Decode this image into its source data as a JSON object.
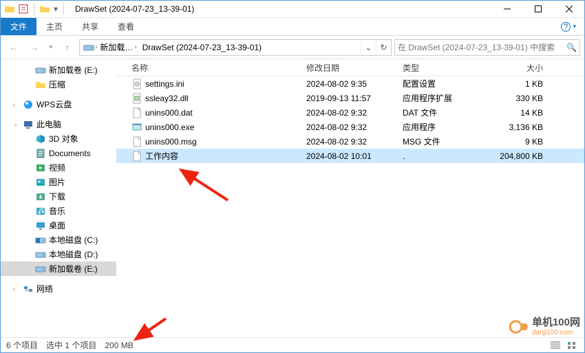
{
  "window": {
    "title": "DrawSet (2024-07-23_13-39-01)"
  },
  "ribbon": {
    "file": "文件",
    "tabs": [
      "主页",
      "共享",
      "查看"
    ]
  },
  "nav": {
    "breadcrumbs": [
      "新加载…",
      "DrawSet (2024-07-23_13-39-01)"
    ],
    "search_placeholder": "在 DrawSet (2024-07-23_13-39-01) 中搜索"
  },
  "tree": {
    "items": [
      {
        "label": "新加载卷 (E:)",
        "icon": "drive",
        "level": 1
      },
      {
        "label": "压缩",
        "icon": "folder",
        "level": 1
      },
      {
        "spacer": true
      },
      {
        "label": "WPS云盘",
        "icon": "wps",
        "level": 0
      },
      {
        "spacer": true
      },
      {
        "label": "此电脑",
        "icon": "pc",
        "level": 0,
        "expand": true
      },
      {
        "label": "3D 对象",
        "icon": "3d",
        "level": 1
      },
      {
        "label": "Documents",
        "icon": "docs",
        "level": 1
      },
      {
        "label": "视频",
        "icon": "video",
        "level": 1
      },
      {
        "label": "图片",
        "icon": "pics",
        "level": 1
      },
      {
        "label": "下载",
        "icon": "dl",
        "level": 1
      },
      {
        "label": "音乐",
        "icon": "music",
        "level": 1
      },
      {
        "label": "桌面",
        "icon": "desktop",
        "level": 1
      },
      {
        "label": "本地磁盘 (C:)",
        "icon": "drivec",
        "level": 1
      },
      {
        "label": "本地磁盘 (D:)",
        "icon": "drive",
        "level": 1
      },
      {
        "label": "新加载卷 (E:)",
        "icon": "drive",
        "level": 1,
        "selected": true
      },
      {
        "spacer": true
      },
      {
        "label": "网络",
        "icon": "net",
        "level": 0
      }
    ]
  },
  "columns": {
    "name": "名称",
    "date": "修改日期",
    "type": "类型",
    "size": "大小"
  },
  "files": [
    {
      "name": "settings.ini",
      "date": "2024-08-02 9:35",
      "type": "配置设置",
      "size": "1 KB",
      "icon": "ini"
    },
    {
      "name": "ssleay32.dll",
      "date": "2019-09-13 11:57",
      "type": "应用程序扩展",
      "size": "330 KB",
      "icon": "dll"
    },
    {
      "name": "unins000.dat",
      "date": "2024-08-02 9:32",
      "type": "DAT 文件",
      "size": "14 KB",
      "icon": "file"
    },
    {
      "name": "unins000.exe",
      "date": "2024-08-02 9:32",
      "type": "应用程序",
      "size": "3,136 KB",
      "icon": "exe"
    },
    {
      "name": "unins000.msg",
      "date": "2024-08-02 9:32",
      "type": "MSG 文件",
      "size": "9 KB",
      "icon": "file"
    },
    {
      "name": "工作内容",
      "date": "2024-08-02 10:01",
      "type": ".",
      "size": "204,800 KB",
      "icon": "file",
      "selected": true
    }
  ],
  "status": {
    "count": "6 个项目",
    "selected": "选中 1 个项目",
    "size": "200 MB"
  },
  "watermark": {
    "name": "单机100网",
    "url": "danji100.com"
  }
}
